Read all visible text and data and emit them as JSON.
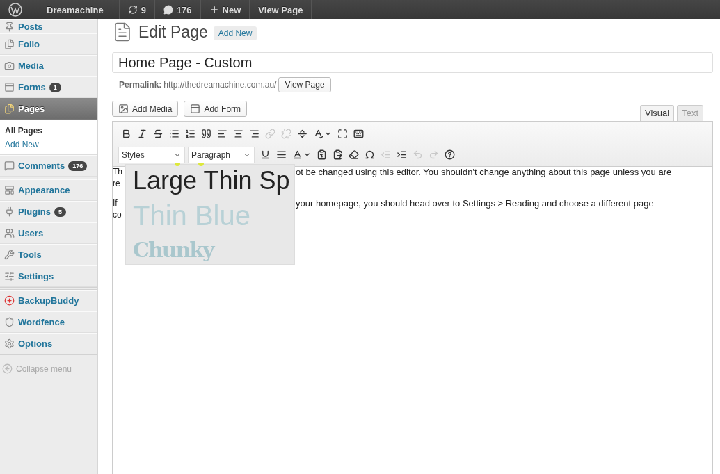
{
  "admin_bar": {
    "site": "Dreamachine",
    "updates": "9",
    "comments": "176",
    "new": "New",
    "view": "View Page"
  },
  "sidebar": {
    "groups": [
      [
        {
          "label": "Posts",
          "selected": false
        },
        {
          "label": "Folio",
          "selected": false
        },
        {
          "label": "Media",
          "selected": false
        },
        {
          "label": "Forms",
          "badge": "1",
          "selected": false
        },
        {
          "label": "Pages",
          "selected": true,
          "children": [
            {
              "label": "All Pages",
              "selected": true
            },
            {
              "label": "Add New",
              "selected": false
            }
          ]
        },
        {
          "label": "Comments",
          "badge": "176",
          "selected": false
        }
      ],
      [
        {
          "label": "Appearance",
          "selected": false
        },
        {
          "label": "Plugins",
          "badge": "5",
          "selected": false
        },
        {
          "label": "Users",
          "selected": false
        },
        {
          "label": "Tools",
          "selected": false
        },
        {
          "label": "Settings",
          "selected": false
        }
      ],
      [
        {
          "label": "BackupBuddy",
          "selected": false
        },
        {
          "label": "Wordfence",
          "selected": false
        },
        {
          "label": "Options",
          "selected": false
        }
      ]
    ],
    "collapse": "Collapse menu"
  },
  "heading": {
    "title": "Edit Page",
    "add_new": "Add New"
  },
  "title_field": {
    "value": "Home Page - Custom"
  },
  "permalink": {
    "label": "Permalink:",
    "url": "http://thedreamachine.com.au/",
    "button": "View Page"
  },
  "media_buttons": [
    "Add Media",
    "Add Form"
  ],
  "editor_tabs": [
    {
      "label": "Visual",
      "selected": true
    },
    {
      "label": "Text",
      "selected": false
    }
  ],
  "toolbar": [
    [
      {
        "kind": "button",
        "disabled": false,
        "menu": false
      },
      {
        "kind": "button",
        "disabled": false,
        "menu": false
      },
      {
        "kind": "button",
        "disabled": false,
        "menu": false
      },
      {
        "kind": "button",
        "disabled": false,
        "menu": false
      },
      {
        "kind": "button",
        "disabled": false,
        "menu": false
      },
      {
        "kind": "button",
        "disabled": false,
        "menu": false
      },
      {
        "kind": "button",
        "disabled": false,
        "menu": false
      },
      {
        "kind": "button",
        "disabled": false,
        "menu": false
      },
      {
        "kind": "button",
        "disabled": false,
        "menu": false
      },
      {
        "kind": "button",
        "disabled": true,
        "menu": false
      },
      {
        "kind": "button",
        "disabled": true,
        "menu": false
      },
      {
        "kind": "button",
        "disabled": false,
        "menu": false
      },
      {
        "kind": "button",
        "disabled": false,
        "menu": true
      },
      {
        "kind": "button",
        "disabled": false,
        "menu": false
      },
      {
        "kind": "button",
        "disabled": false,
        "menu": false
      }
    ],
    [
      {
        "kind": "select",
        "value": "Styles"
      },
      {
        "kind": "select",
        "value": "Paragraph"
      },
      {
        "kind": "button",
        "disabled": false,
        "menu": false
      },
      {
        "kind": "button",
        "disabled": false,
        "menu": false
      },
      {
        "kind": "button",
        "disabled": false,
        "menu": true
      },
      {
        "kind": "button",
        "disabled": false,
        "menu": false
      },
      {
        "kind": "button",
        "disabled": false,
        "menu": false
      },
      {
        "kind": "button",
        "disabled": false,
        "menu": false
      },
      {
        "kind": "button",
        "disabled": false,
        "menu": false
      },
      {
        "kind": "button",
        "disabled": true,
        "menu": false
      },
      {
        "kind": "button",
        "disabled": false,
        "menu": false
      },
      {
        "kind": "button",
        "disabled": true,
        "menu": false
      },
      {
        "kind": "button",
        "disabled": true,
        "menu": false
      },
      {
        "kind": "button",
        "disabled": false,
        "menu": false
      }
    ]
  ],
  "content": [
    [
      {
        "left": "Th",
        "right": "ot be changed using this editor. You shouldn't change anything about this page unless you are"
      },
      {
        "left": "re"
      }
    ],
    [
      {
        "left": "If",
        "right": "your homepage, you should head over to Settings > Reading and choose a different page"
      },
      {
        "left": "co"
      }
    ]
  ],
  "styles_menu": [
    {
      "kind": "large",
      "label": "Large Thin Sp"
    },
    {
      "kind": "thin",
      "label": "Thin Blue"
    },
    {
      "kind": "chunky",
      "label": "Chunky"
    }
  ]
}
